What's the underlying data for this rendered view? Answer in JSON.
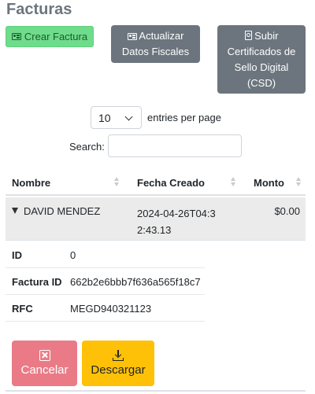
{
  "page": {
    "title": "Facturas"
  },
  "actions": {
    "create_label": "Crear Factura",
    "fiscal_line1": "Actualizar",
    "fiscal_line2": "Datos Fiscales",
    "csd_line1": "Subir",
    "csd_line2": "Certificados de",
    "csd_line3": "Sello Digital",
    "csd_line4": "(CSD)"
  },
  "table_controls": {
    "page_size": "10",
    "entries_label": "entries per page",
    "search_label": "Search:",
    "search_value": ""
  },
  "table": {
    "columns": [
      "Nombre",
      "Fecha Creado",
      "Monto"
    ],
    "rows": [
      {
        "nombre": "DAVID MENDEZ",
        "fecha": "2024-04-26T04:32:43.13",
        "monto": "$0.00",
        "expanded": true
      }
    ]
  },
  "detail": [
    {
      "label": "ID",
      "value": "0"
    },
    {
      "label": "Factura ID",
      "value": "662b2e6bbb7f636a565f18c7"
    },
    {
      "label": "RFC",
      "value": "MEGD940321123"
    }
  ],
  "row_actions": {
    "cancel_label": "Cancelar",
    "download_label": "Descargar"
  },
  "colors": {
    "success": "#6fdc8c",
    "secondary": "#6c757d",
    "danger": "#ea7b86",
    "warning": "#ffc107"
  },
  "icons": {
    "create": "id-card-icon",
    "fiscal": "id-card-icon",
    "csd": "file-certificate-icon",
    "cancel": "x-square-icon",
    "download": "download-icon"
  }
}
